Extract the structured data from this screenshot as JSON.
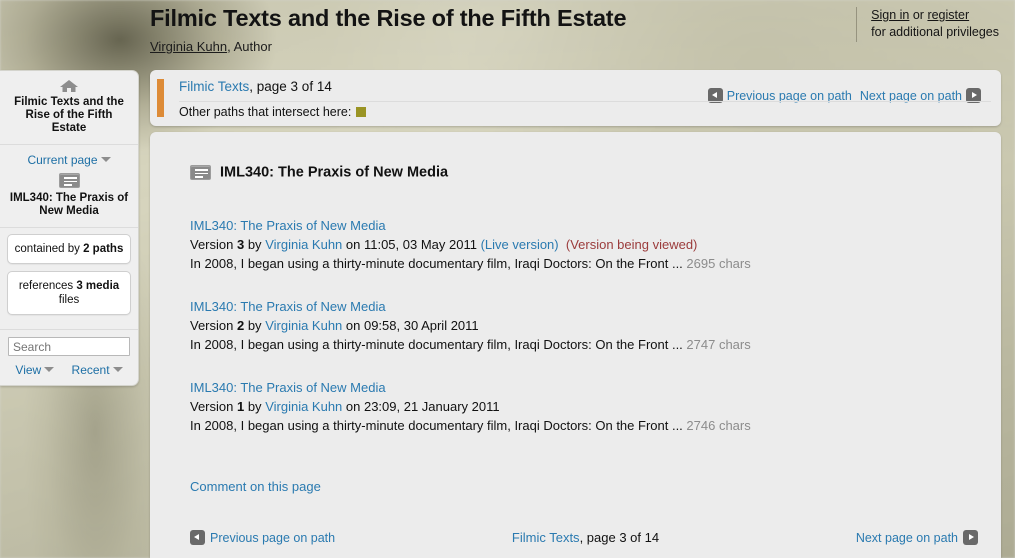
{
  "header": {
    "title": "Filmic Texts and the Rise of the Fifth Estate",
    "author_name": "Virginia Kuhn",
    "author_role": ", Author",
    "signin_link": "Sign in",
    "signin_or": " or ",
    "register_link": "register",
    "signin_sub": "for additional privileges"
  },
  "sidebar": {
    "home_icon": "home-icon",
    "home_label": "Filmic Texts and the Rise of the Fifth Estate",
    "current_page_label": "Current page",
    "current_doc_icon": "document-icon",
    "current_doc_label": "IML340: The Praxis of New Media",
    "boxes": [
      {
        "prefix": "contained by ",
        "strong": "2 paths",
        "suffix": ""
      },
      {
        "prefix": "references ",
        "strong": "3 media",
        "suffix": " files"
      }
    ],
    "search_placeholder": "Search",
    "view_label": "View",
    "recent_label": "Recent"
  },
  "pathbar": {
    "path_name": "Filmic Texts",
    "path_position": ", page 3 of 14",
    "intersect_label": "Other paths that intersect here:",
    "intersect_chip_color": "#9a9424",
    "accent_color": "#dd8b37",
    "prev_label": "Previous page on path",
    "next_label": "Next page on path"
  },
  "content": {
    "doc_icon": "document-icon",
    "title": "IML340: The Praxis of New Media",
    "versions": [
      {
        "title": "IML340: The Praxis of New Media",
        "version_word": "Version ",
        "version_number": "3",
        "by": " by ",
        "author": "Virginia Kuhn",
        "on": " on ",
        "timestamp": "11:05, 03 May 2011",
        "live_label": "(Live version)",
        "viewed_label": "(Version being viewed)",
        "excerpt": "In 2008, I began using a thirty-minute documentary film, Iraqi Doctors: On the Front ...",
        "chars": "2695 chars"
      },
      {
        "title": "IML340: The Praxis of New Media",
        "version_word": "Version ",
        "version_number": "2",
        "by": " by ",
        "author": "Virginia Kuhn",
        "on": " on ",
        "timestamp": "09:58, 30 April 2011",
        "live_label": "",
        "viewed_label": "",
        "excerpt": "In 2008, I began using a thirty-minute documentary film, Iraqi Doctors: On the Front ...",
        "chars": "2747 chars"
      },
      {
        "title": "IML340: The Praxis of New Media",
        "version_word": "Version ",
        "version_number": "1",
        "by": " by ",
        "author": "Virginia Kuhn",
        "on": " on ",
        "timestamp": "23:09, 21 January 2011",
        "live_label": "",
        "viewed_label": "",
        "excerpt": "In 2008, I began using a thirty-minute documentary film, Iraqi Doctors: On the Front ...",
        "chars": "2746 chars"
      }
    ],
    "comment_link": "Comment on this page",
    "footer": {
      "prev_label": "Previous page on path",
      "path_name": "Filmic Texts",
      "path_position": ", page 3 of 14",
      "next_label": "Next page on path"
    }
  }
}
